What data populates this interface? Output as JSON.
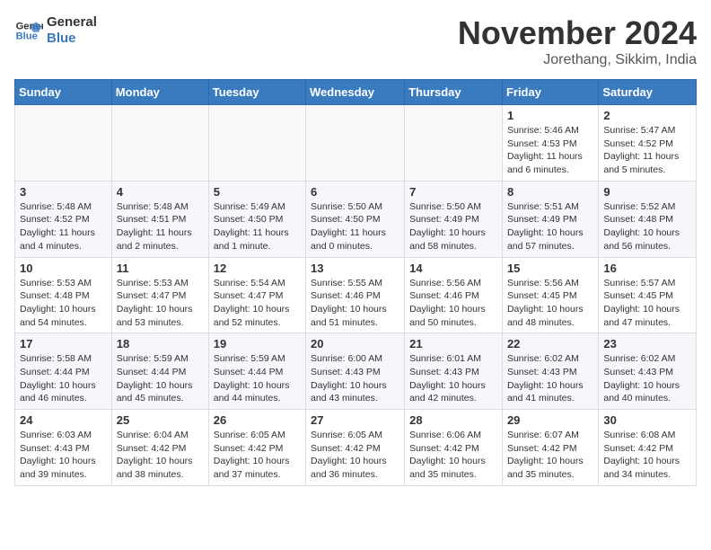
{
  "header": {
    "logo_line1": "General",
    "logo_line2": "Blue",
    "month": "November 2024",
    "location": "Jorethang, Sikkim, India"
  },
  "weekdays": [
    "Sunday",
    "Monday",
    "Tuesday",
    "Wednesday",
    "Thursday",
    "Friday",
    "Saturday"
  ],
  "weeks": [
    [
      {
        "day": "",
        "detail": ""
      },
      {
        "day": "",
        "detail": ""
      },
      {
        "day": "",
        "detail": ""
      },
      {
        "day": "",
        "detail": ""
      },
      {
        "day": "",
        "detail": ""
      },
      {
        "day": "1",
        "detail": "Sunrise: 5:46 AM\nSunset: 4:53 PM\nDaylight: 11 hours\nand 6 minutes."
      },
      {
        "day": "2",
        "detail": "Sunrise: 5:47 AM\nSunset: 4:52 PM\nDaylight: 11 hours\nand 5 minutes."
      }
    ],
    [
      {
        "day": "3",
        "detail": "Sunrise: 5:48 AM\nSunset: 4:52 PM\nDaylight: 11 hours\nand 4 minutes."
      },
      {
        "day": "4",
        "detail": "Sunrise: 5:48 AM\nSunset: 4:51 PM\nDaylight: 11 hours\nand 2 minutes."
      },
      {
        "day": "5",
        "detail": "Sunrise: 5:49 AM\nSunset: 4:50 PM\nDaylight: 11 hours\nand 1 minute."
      },
      {
        "day": "6",
        "detail": "Sunrise: 5:50 AM\nSunset: 4:50 PM\nDaylight: 11 hours\nand 0 minutes."
      },
      {
        "day": "7",
        "detail": "Sunrise: 5:50 AM\nSunset: 4:49 PM\nDaylight: 10 hours\nand 58 minutes."
      },
      {
        "day": "8",
        "detail": "Sunrise: 5:51 AM\nSunset: 4:49 PM\nDaylight: 10 hours\nand 57 minutes."
      },
      {
        "day": "9",
        "detail": "Sunrise: 5:52 AM\nSunset: 4:48 PM\nDaylight: 10 hours\nand 56 minutes."
      }
    ],
    [
      {
        "day": "10",
        "detail": "Sunrise: 5:53 AM\nSunset: 4:48 PM\nDaylight: 10 hours\nand 54 minutes."
      },
      {
        "day": "11",
        "detail": "Sunrise: 5:53 AM\nSunset: 4:47 PM\nDaylight: 10 hours\nand 53 minutes."
      },
      {
        "day": "12",
        "detail": "Sunrise: 5:54 AM\nSunset: 4:47 PM\nDaylight: 10 hours\nand 52 minutes."
      },
      {
        "day": "13",
        "detail": "Sunrise: 5:55 AM\nSunset: 4:46 PM\nDaylight: 10 hours\nand 51 minutes."
      },
      {
        "day": "14",
        "detail": "Sunrise: 5:56 AM\nSunset: 4:46 PM\nDaylight: 10 hours\nand 50 minutes."
      },
      {
        "day": "15",
        "detail": "Sunrise: 5:56 AM\nSunset: 4:45 PM\nDaylight: 10 hours\nand 48 minutes."
      },
      {
        "day": "16",
        "detail": "Sunrise: 5:57 AM\nSunset: 4:45 PM\nDaylight: 10 hours\nand 47 minutes."
      }
    ],
    [
      {
        "day": "17",
        "detail": "Sunrise: 5:58 AM\nSunset: 4:44 PM\nDaylight: 10 hours\nand 46 minutes."
      },
      {
        "day": "18",
        "detail": "Sunrise: 5:59 AM\nSunset: 4:44 PM\nDaylight: 10 hours\nand 45 minutes."
      },
      {
        "day": "19",
        "detail": "Sunrise: 5:59 AM\nSunset: 4:44 PM\nDaylight: 10 hours\nand 44 minutes."
      },
      {
        "day": "20",
        "detail": "Sunrise: 6:00 AM\nSunset: 4:43 PM\nDaylight: 10 hours\nand 43 minutes."
      },
      {
        "day": "21",
        "detail": "Sunrise: 6:01 AM\nSunset: 4:43 PM\nDaylight: 10 hours\nand 42 minutes."
      },
      {
        "day": "22",
        "detail": "Sunrise: 6:02 AM\nSunset: 4:43 PM\nDaylight: 10 hours\nand 41 minutes."
      },
      {
        "day": "23",
        "detail": "Sunrise: 6:02 AM\nSunset: 4:43 PM\nDaylight: 10 hours\nand 40 minutes."
      }
    ],
    [
      {
        "day": "24",
        "detail": "Sunrise: 6:03 AM\nSunset: 4:43 PM\nDaylight: 10 hours\nand 39 minutes."
      },
      {
        "day": "25",
        "detail": "Sunrise: 6:04 AM\nSunset: 4:42 PM\nDaylight: 10 hours\nand 38 minutes."
      },
      {
        "day": "26",
        "detail": "Sunrise: 6:05 AM\nSunset: 4:42 PM\nDaylight: 10 hours\nand 37 minutes."
      },
      {
        "day": "27",
        "detail": "Sunrise: 6:05 AM\nSunset: 4:42 PM\nDaylight: 10 hours\nand 36 minutes."
      },
      {
        "day": "28",
        "detail": "Sunrise: 6:06 AM\nSunset: 4:42 PM\nDaylight: 10 hours\nand 35 minutes."
      },
      {
        "day": "29",
        "detail": "Sunrise: 6:07 AM\nSunset: 4:42 PM\nDaylight: 10 hours\nand 35 minutes."
      },
      {
        "day": "30",
        "detail": "Sunrise: 6:08 AM\nSunset: 4:42 PM\nDaylight: 10 hours\nand 34 minutes."
      }
    ]
  ]
}
